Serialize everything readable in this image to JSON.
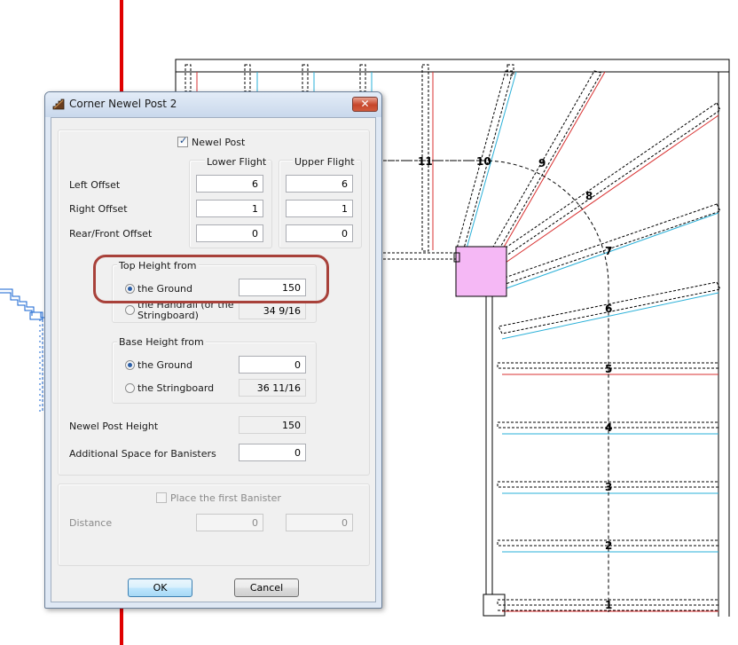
{
  "dialog": {
    "title": "Corner Newel Post 2",
    "close_glyph": "✕",
    "newel_post_checkbox": {
      "label": "Newel Post",
      "checked": true
    },
    "columns": {
      "lower": "Lower Flight",
      "upper": "Upper Flight"
    },
    "offsets": [
      {
        "label": "Left Offset",
        "lower": "6",
        "upper": "6"
      },
      {
        "label": "Right Offset",
        "lower": "1",
        "upper": "1"
      },
      {
        "label": "Rear/Front Offset",
        "lower": "0",
        "upper": "0"
      }
    ],
    "top_height": {
      "title": "Top Height from",
      "ground_label": "the Ground",
      "ground_value": "150",
      "handrail_label_line1": "the Handrail (or the",
      "handrail_label_line2": "Stringboard)",
      "handrail_value": "34 9/16",
      "selected": "ground"
    },
    "base_height": {
      "title": "Base Height from",
      "ground_label": "the Ground",
      "ground_value": "0",
      "stringboard_label": "the Stringboard",
      "stringboard_value": "36 11/16",
      "selected": "ground"
    },
    "newel_post_height": {
      "label": "Newel Post Height",
      "value": "150"
    },
    "additional_space": {
      "label": "Additional Space for Banisters",
      "value": "0"
    },
    "first_banister": {
      "label": "Place the first Banister",
      "checked": false
    },
    "distance": {
      "label": "Distance",
      "value1": "0",
      "value2": "0"
    },
    "ok_label": "OK",
    "cancel_label": "Cancel"
  },
  "drawing": {
    "step_numbers": [
      "1",
      "2",
      "3",
      "4",
      "5",
      "6",
      "7",
      "8",
      "9",
      "10",
      "11"
    ],
    "colors": {
      "red_line": "#e00000",
      "stair_red": "#d83030",
      "stair_cyan": "#2ab0d8",
      "newel_fill": "#f5b8f5",
      "outline": "#000000",
      "blue_profile": "#1060d0"
    }
  }
}
